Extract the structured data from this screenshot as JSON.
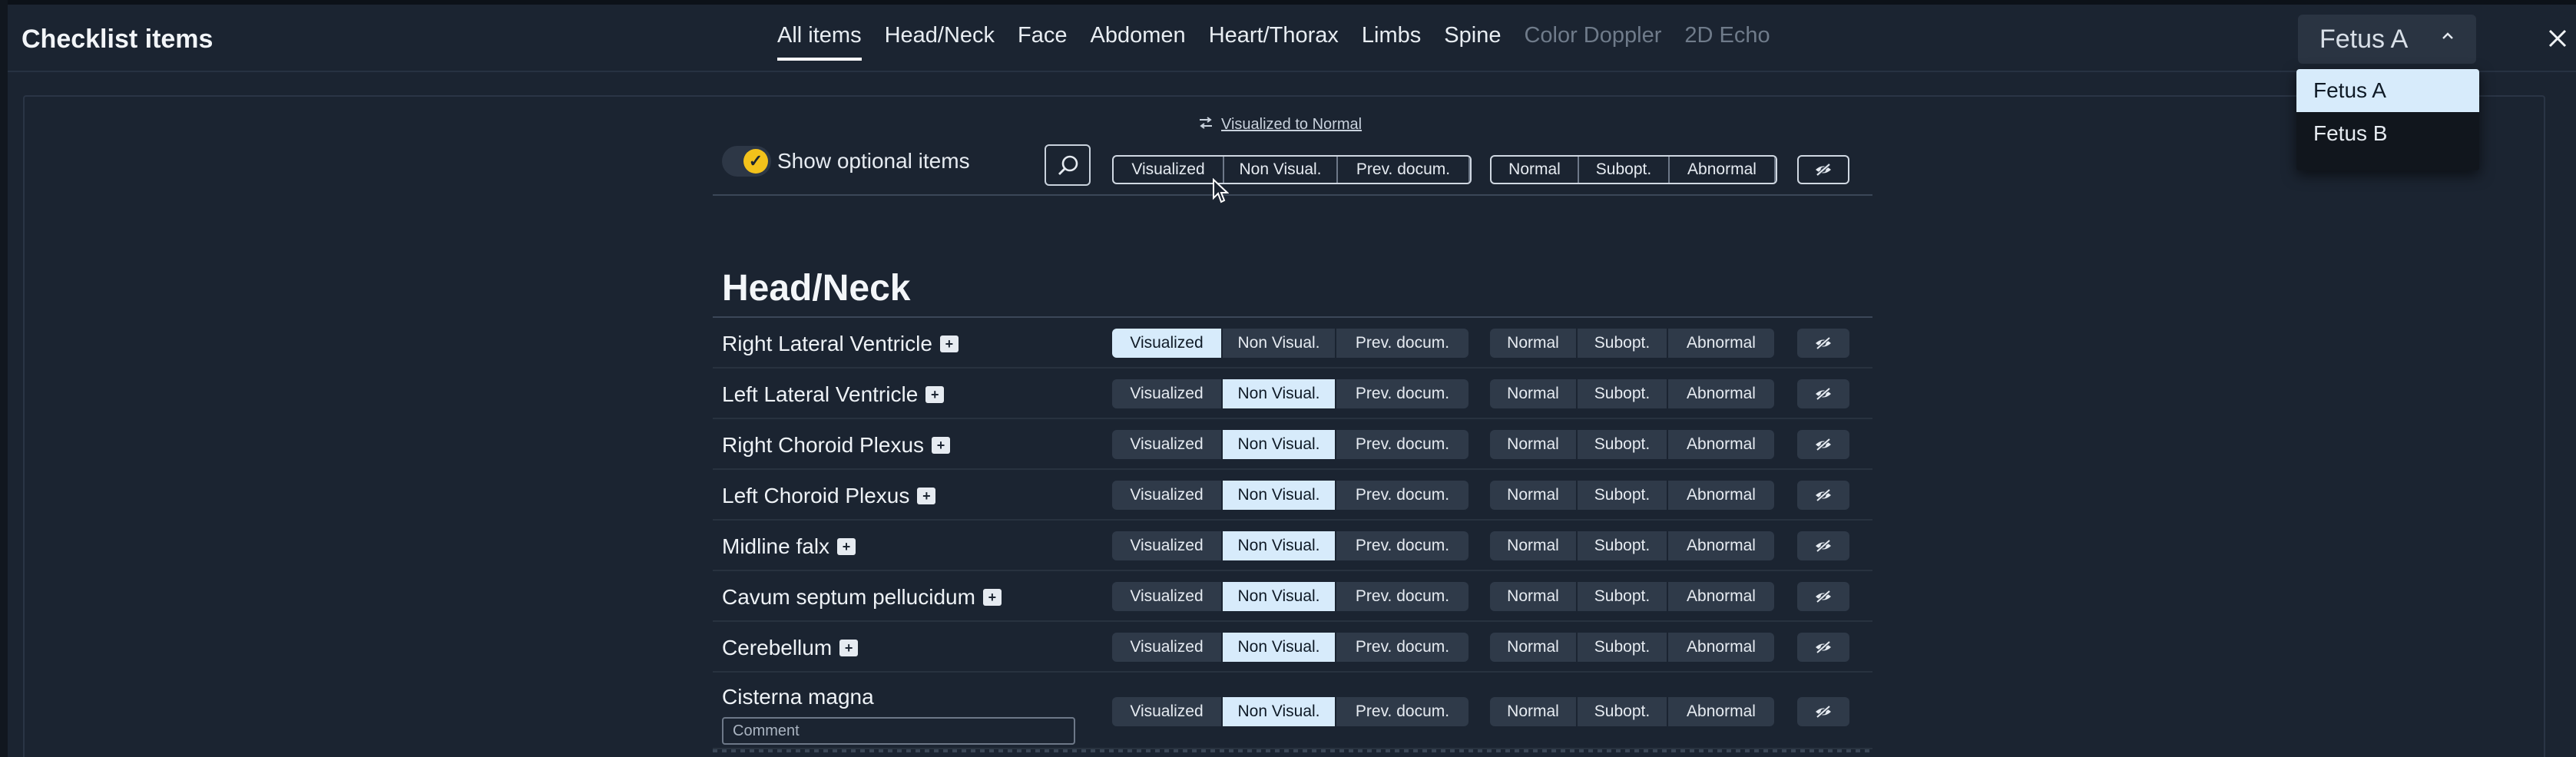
{
  "header": {
    "title": "Checklist items",
    "tabs": [
      {
        "label": "All items",
        "active": true,
        "disabled": false
      },
      {
        "label": "Head/Neck",
        "active": false,
        "disabled": false
      },
      {
        "label": "Face",
        "active": false,
        "disabled": false
      },
      {
        "label": "Abdomen",
        "active": false,
        "disabled": false
      },
      {
        "label": "Heart/Thorax",
        "active": false,
        "disabled": false
      },
      {
        "label": "Limbs",
        "active": false,
        "disabled": false
      },
      {
        "label": "Spine",
        "active": false,
        "disabled": false
      },
      {
        "label": "Color Doppler",
        "active": false,
        "disabled": true
      },
      {
        "label": "2D Echo",
        "active": false,
        "disabled": true
      }
    ],
    "fetus_select": {
      "value": "Fetus A",
      "icon": "chevron-up-icon"
    },
    "fetus_options": [
      "Fetus A",
      "Fetus B"
    ],
    "close_icon": "close-icon"
  },
  "toolbar": {
    "visualized_to_normal": "Visualized to Normal",
    "swap_icon": "swap-arrows-icon",
    "show_optional": "Show optional items",
    "search_icon": "search-icon",
    "visibility_options": [
      "Visualized",
      "Non Visual.",
      "Prev. docum."
    ],
    "quality_options": [
      "Normal",
      "Subopt.",
      "Abnormal"
    ],
    "hide_icon": "eye-off-icon"
  },
  "section": {
    "title": "Head/Neck",
    "items": [
      {
        "label": "Right Lateral Ventricle",
        "visibility": "Visualized",
        "has_comment_icon": true
      },
      {
        "label": "Left Lateral Ventricle",
        "visibility": "Non Visual.",
        "has_comment_icon": true
      },
      {
        "label": "Right Choroid Plexus",
        "visibility": "Non Visual.",
        "has_comment_icon": true
      },
      {
        "label": "Left Choroid Plexus",
        "visibility": "Non Visual.",
        "has_comment_icon": true
      },
      {
        "label": "Midline falx",
        "visibility": "Non Visual.",
        "has_comment_icon": true
      },
      {
        "label": "Cavum septum pellucidum",
        "visibility": "Non Visual.",
        "has_comment_icon": true
      },
      {
        "label": "Cerebellum",
        "visibility": "Non Visual.",
        "has_comment_icon": true
      },
      {
        "label": "Cisterna magna",
        "visibility": "Non Visual.",
        "has_comment_icon": false,
        "comment_placeholder": "Comment"
      }
    ]
  },
  "colors": {
    "background": "#1b2431",
    "selected": "#d7ebfb",
    "toggle_on": "#f3c21b",
    "button": "#2f3a49"
  }
}
